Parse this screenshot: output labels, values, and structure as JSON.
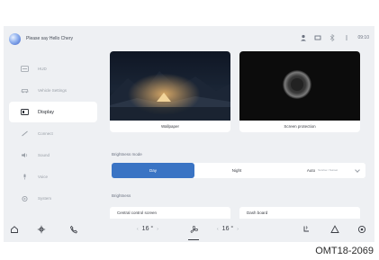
{
  "assistant": {
    "greeting": "Please say Hello Chery"
  },
  "status_bar": {
    "time": "09:10"
  },
  "sidebar": {
    "items": [
      {
        "label": "HUD",
        "icon": "hud-icon",
        "active": false
      },
      {
        "label": "Vehicle Settings",
        "icon": "car-icon",
        "active": false
      },
      {
        "label": "Display",
        "icon": "display-icon",
        "active": true
      },
      {
        "label": "Connect",
        "icon": "link-icon",
        "active": false
      },
      {
        "label": "Sound",
        "icon": "speaker-icon",
        "active": false
      },
      {
        "label": "Voice",
        "icon": "microphone-icon",
        "active": false
      },
      {
        "label": "System",
        "icon": "gear-icon",
        "active": false
      }
    ]
  },
  "display": {
    "wallpaper_label": "Wallpaper",
    "screen_protection_label": "Screen protection",
    "brightness_mode_label": "Brightness mode",
    "modes": {
      "day": "Day",
      "night": "Night",
      "auto": "Auto",
      "auto_sub": "Sunrise / Sunset"
    },
    "brightness_label": "Brightness",
    "central_screen_label": "Central control screen",
    "dashboard_label": "Dash board"
  },
  "climate": {
    "left_temp": "16 °",
    "right_temp": "16 °"
  },
  "figure_code": "OMT18-2069"
}
